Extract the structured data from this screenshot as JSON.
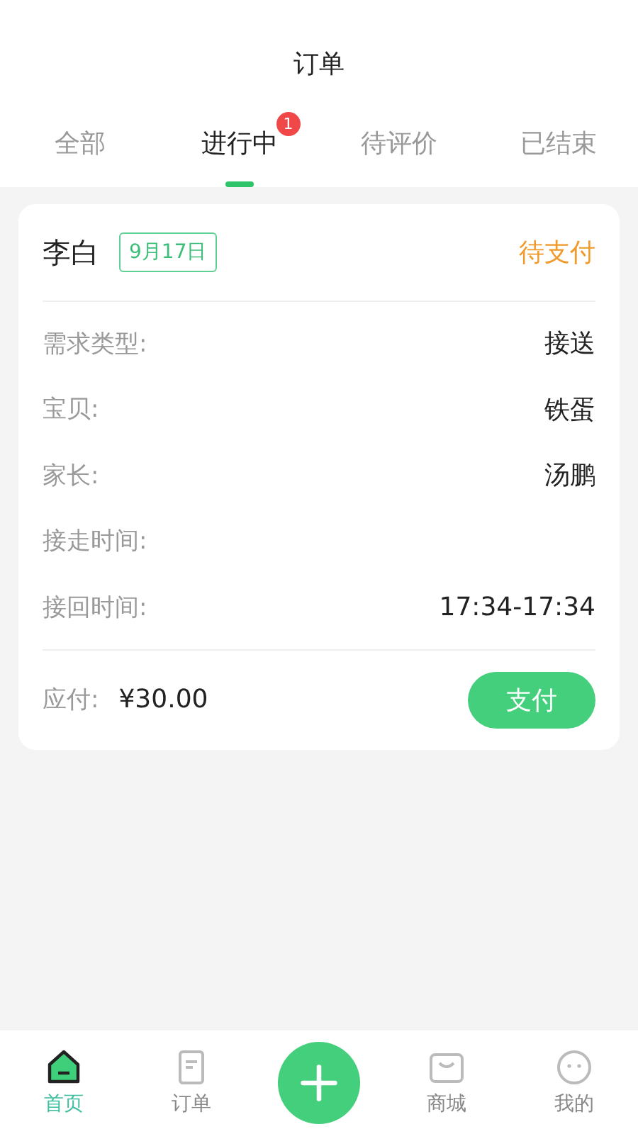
{
  "header": {
    "title": "订单"
  },
  "tabs": [
    {
      "label": "全部",
      "selected": false
    },
    {
      "label": "进行中",
      "selected": true,
      "badge": "1"
    },
    {
      "label": "待评价",
      "selected": false
    },
    {
      "label": "已结束",
      "selected": false
    }
  ],
  "orders": [
    {
      "name": "李白",
      "date": "9月17日",
      "status": "待支付",
      "fields": [
        {
          "label": "需求类型:",
          "value": "接送"
        },
        {
          "label": "宝贝:",
          "value": "铁蛋"
        },
        {
          "label": "家长:",
          "value": "汤鹏"
        },
        {
          "label": "接走时间:"
        },
        {
          "label": "接回时间:",
          "value": "17:34-17:34"
        }
      ],
      "amount_label": "应付:",
      "amount": "¥30.00",
      "action": "支付"
    }
  ],
  "bottom_nav": [
    {
      "kind": "home",
      "label": "首页",
      "selected": true
    },
    {
      "kind": "orders",
      "label": "订单",
      "selected": false
    },
    {
      "kind": "add"
    },
    {
      "kind": "shop",
      "label": "商城",
      "selected": false
    },
    {
      "kind": "profile",
      "label": "我的",
      "selected": false
    }
  ]
}
